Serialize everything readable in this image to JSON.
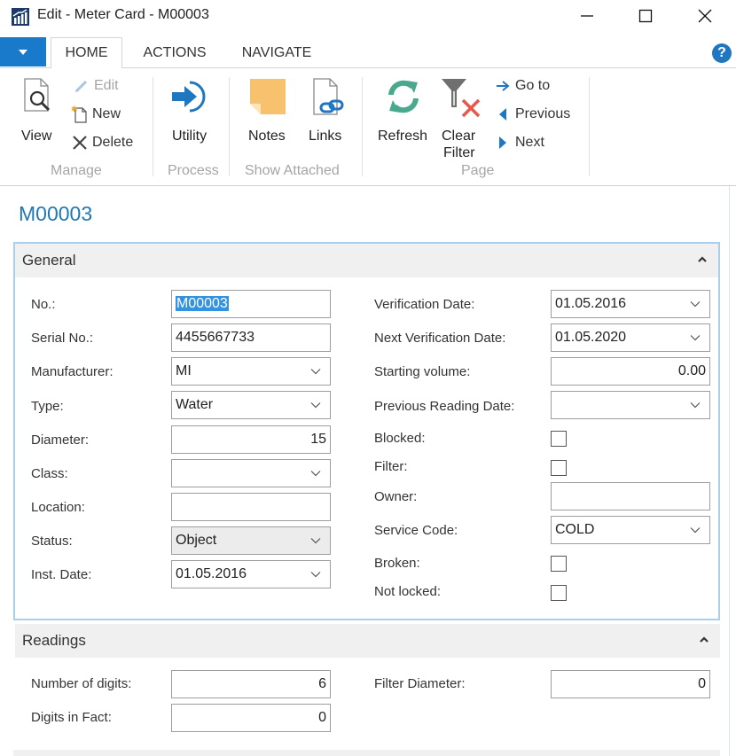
{
  "window": {
    "title": "Edit - Meter Card - M00003",
    "app_icon": "dynamics-nav-chart-icon",
    "controls": {
      "minimize": "minimize-icon",
      "maximize": "maximize-icon",
      "close": "close-icon"
    }
  },
  "ribbon": {
    "app_menu_icon": "dropdown-triangle-icon",
    "tabs": [
      {
        "label": "HOME",
        "active": true
      },
      {
        "label": "ACTIONS",
        "active": false
      },
      {
        "label": "NAVIGATE",
        "active": false
      }
    ],
    "help_label": "?",
    "groups": [
      {
        "label": "Manage",
        "buttons": [
          {
            "label": "View",
            "icon": "view-document-icon",
            "enabled": true
          },
          {
            "label": "Edit",
            "icon": "pencil-icon",
            "enabled": false
          },
          {
            "label": "New",
            "icon": "new-document-icon",
            "enabled": true
          },
          {
            "label": "Delete",
            "icon": "delete-x-icon",
            "enabled": true
          }
        ]
      },
      {
        "label": "Process",
        "buttons": [
          {
            "label": "Utility",
            "icon": "utility-arrow-icon",
            "enabled": true
          }
        ]
      },
      {
        "label": "Show Attached",
        "buttons": [
          {
            "label": "Notes",
            "icon": "note-icon",
            "enabled": true
          },
          {
            "label": "Links",
            "icon": "links-icon",
            "enabled": true
          }
        ]
      },
      {
        "label": "Page",
        "buttons": [
          {
            "label": "Refresh",
            "icon": "refresh-icon",
            "enabled": true
          },
          {
            "label": "Clear Filter",
            "label_line1": "Clear",
            "label_line2": "Filter",
            "icon": "clear-filter-icon",
            "enabled": true
          },
          {
            "label": "Go to",
            "icon": "goto-arrow-icon",
            "enabled": true
          },
          {
            "label": "Previous",
            "icon": "previous-icon",
            "enabled": true
          },
          {
            "label": "Next",
            "icon": "next-icon",
            "enabled": true
          }
        ]
      }
    ]
  },
  "page": {
    "heading": "M00003"
  },
  "general": {
    "title": "General",
    "left": [
      {
        "label": "No.:",
        "value": "M00003",
        "type": "text",
        "selected": true
      },
      {
        "label": "Serial No.:",
        "value": "4455667733",
        "type": "text"
      },
      {
        "label": "Manufacturer:",
        "value": "MI",
        "type": "dropdown"
      },
      {
        "label": "Type:",
        "value": "Water",
        "type": "dropdown"
      },
      {
        "label": "Diameter:",
        "value": "15",
        "type": "number"
      },
      {
        "label": "Class:",
        "value": "",
        "type": "dropdown"
      },
      {
        "label": "Location:",
        "value": "",
        "type": "text"
      },
      {
        "label": "Status:",
        "value": "Object",
        "type": "dropdown",
        "readonly": true
      },
      {
        "label": "Inst. Date:",
        "value": "01.05.2016",
        "type": "dropdown"
      }
    ],
    "right": [
      {
        "label": "Verification Date:",
        "value": "01.05.2016",
        "type": "dropdown"
      },
      {
        "label": "Next Verification Date:",
        "value": "01.05.2020",
        "type": "dropdown"
      },
      {
        "label": "Starting volume:",
        "value": "0.00",
        "type": "number"
      },
      {
        "label": "Previous Reading Date:",
        "value": "",
        "type": "dropdown"
      },
      {
        "label": "Blocked:",
        "checked": false,
        "type": "checkbox"
      },
      {
        "label": "Filter:",
        "checked": false,
        "type": "checkbox"
      },
      {
        "label": "Owner:",
        "value": "",
        "type": "text"
      },
      {
        "label": "Service Code:",
        "value": "COLD",
        "type": "dropdown"
      },
      {
        "label": "Broken:",
        "checked": false,
        "type": "checkbox"
      },
      {
        "label": "Not locked:",
        "checked": false,
        "type": "checkbox"
      }
    ]
  },
  "readings": {
    "title": "Readings",
    "left": [
      {
        "label": "Number of digits:",
        "value": "6",
        "type": "number"
      },
      {
        "label": "Digits in Fact:",
        "value": "0",
        "type": "number"
      }
    ],
    "right": [
      {
        "label": "Filter Diameter:",
        "value": "0",
        "type": "number"
      }
    ]
  },
  "colors": {
    "accent_blue": "#1979ca",
    "heading_blue": "#1f78b4",
    "fasttab_border": "#a8cfee",
    "selection": "#3393df"
  }
}
